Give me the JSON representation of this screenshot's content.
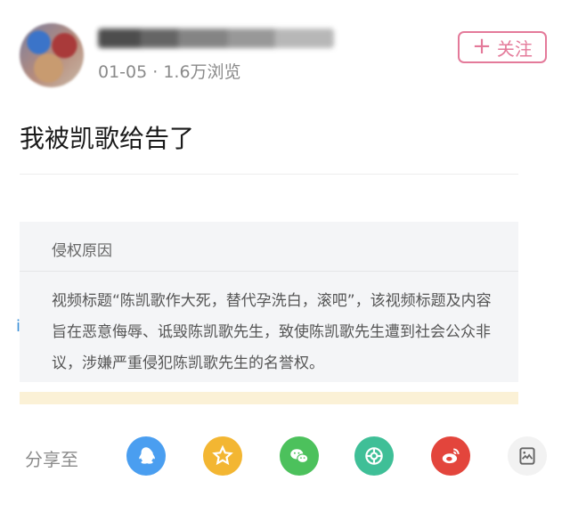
{
  "post": {
    "meta": "01-05 · 1.6万浏览",
    "follow_label": "关注",
    "title": "我被凯歌给告了"
  },
  "card": {
    "header": "侵权原因",
    "body": "视频标题“陈凯歌作大死，替代孕洗白，滚吧”，该视频标题及内容旨在恶意侮辱、诋毁陈凯歌先生，致使陈凯歌先生遭到社会公众非议，涉嫌严重侵犯陈凯歌先生的名誉权。",
    "side_mark": "i"
  },
  "share": {
    "label": "分享至",
    "icons": [
      {
        "name": "qq-icon",
        "color": "#4a9ef0"
      },
      {
        "name": "qzone-star-icon",
        "color": "#f3b632"
      },
      {
        "name": "wechat-icon",
        "color": "#4cc15c"
      },
      {
        "name": "moments-icon",
        "color": "#3fbf97"
      },
      {
        "name": "weibo-icon",
        "color": "#e3453c"
      },
      {
        "name": "screenshot-icon",
        "color": "#f2f2f2"
      }
    ]
  }
}
